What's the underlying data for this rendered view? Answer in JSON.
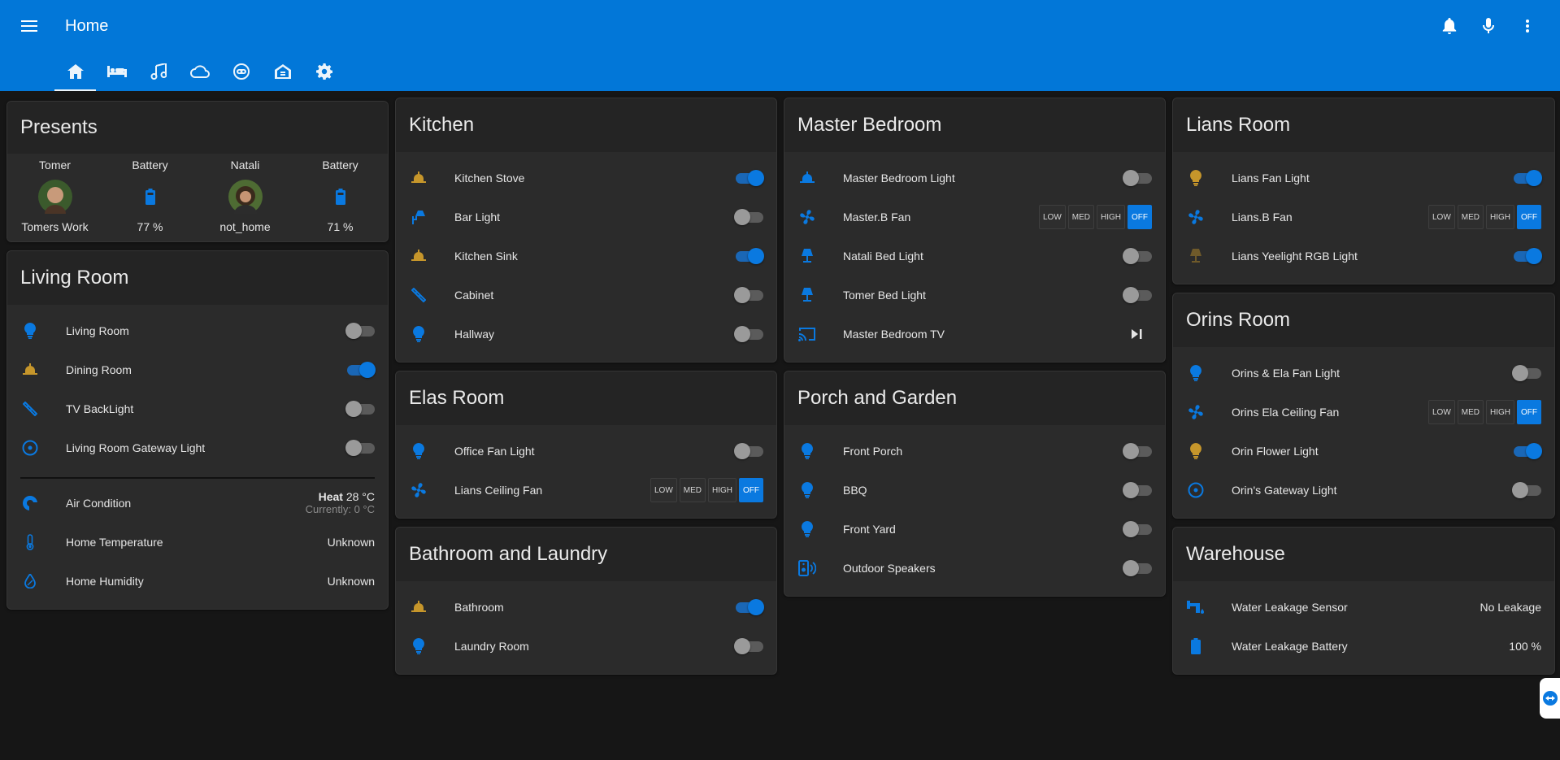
{
  "header": {
    "title": "Home"
  },
  "tabs": [
    "home-icon",
    "bed-icon",
    "music-icon",
    "cloud-icon",
    "robot-icon",
    "house-shield-icon",
    "gear-icon"
  ],
  "colors": {
    "accent": "#0277d8",
    "icon_blue": "#0a79e0",
    "icon_gold": "#c6962b"
  },
  "presents": {
    "title": "Presents",
    "people": [
      {
        "name": "Tomer",
        "state": "Tomers Work",
        "battery_label": "Battery",
        "battery": "77 %"
      },
      {
        "name": "Natali",
        "state": "not_home",
        "battery_label": "Battery",
        "battery": "71 %"
      }
    ]
  },
  "living_room": {
    "title": "Living Room",
    "items": [
      {
        "name": "Living Room",
        "icon": "bulb-icon",
        "on": false
      },
      {
        "name": "Dining Room",
        "icon": "ceiling-light-icon",
        "on": true
      },
      {
        "name": "TV BackLight",
        "icon": "led-strip-icon",
        "on": false
      },
      {
        "name": "Living Room Gateway Light",
        "icon": "gateway-icon",
        "on": false
      }
    ],
    "sensors": [
      {
        "name": "Air Condition",
        "mode": "Heat",
        "temp": "28 °C",
        "current": "Currently: 0 °C"
      },
      {
        "name": "Home Temperature",
        "value": "Unknown"
      },
      {
        "name": "Home Humidity",
        "value": "Unknown"
      }
    ]
  },
  "kitchen": {
    "title": "Kitchen",
    "items": [
      {
        "name": "Kitchen Stove",
        "on": true
      },
      {
        "name": "Bar Light",
        "on": false
      },
      {
        "name": "Kitchen Sink",
        "on": true
      },
      {
        "name": "Cabinet",
        "on": false
      },
      {
        "name": "Hallway",
        "on": false
      }
    ]
  },
  "elas_room": {
    "title": "Elas Room",
    "items": [
      {
        "name": "Office Fan Light",
        "on": false
      },
      {
        "name": "Lians Ceiling Fan"
      }
    ]
  },
  "bathroom": {
    "title": "Bathroom and Laundry",
    "items": [
      {
        "name": "Bathroom",
        "on": true
      },
      {
        "name": "Laundry Room",
        "on": false
      }
    ]
  },
  "master_bedroom": {
    "title": "Master Bedroom",
    "items": [
      {
        "name": "Master Bedroom Light",
        "on": false
      },
      {
        "name": "Master.B Fan"
      },
      {
        "name": "Natali Bed Light",
        "on": false
      },
      {
        "name": "Tomer Bed Light",
        "on": false
      },
      {
        "name": "Master Bedroom TV"
      }
    ]
  },
  "porch": {
    "title": "Porch and Garden",
    "items": [
      {
        "name": "Front Porch",
        "on": false
      },
      {
        "name": "BBQ",
        "on": false
      },
      {
        "name": "Front Yard",
        "on": false
      },
      {
        "name": "Outdoor Speakers",
        "on": false
      }
    ]
  },
  "lians_room": {
    "title": "Lians Room",
    "items": [
      {
        "name": "Lians Fan Light",
        "on": true
      },
      {
        "name": "Lians.B Fan"
      },
      {
        "name": "Lians Yeelight RGB Light",
        "on": true
      }
    ]
  },
  "orins_room": {
    "title": "Orins Room",
    "items": [
      {
        "name": "Orins & Ela Fan Light",
        "on": false
      },
      {
        "name": "Orins Ela Ceiling Fan"
      },
      {
        "name": "Orin Flower Light",
        "on": true
      },
      {
        "name": "Orin's Gateway Light",
        "on": false
      }
    ]
  },
  "warehouse": {
    "title": "Warehouse",
    "items": [
      {
        "name": "Water Leakage Sensor",
        "value": "No Leakage"
      },
      {
        "name": "Water Leakage Battery",
        "value": "100 %"
      }
    ]
  },
  "fan_speeds": {
    "low": "LOW",
    "med": "MED",
    "high": "HIGH",
    "off": "OFF",
    "selected": "OFF"
  }
}
